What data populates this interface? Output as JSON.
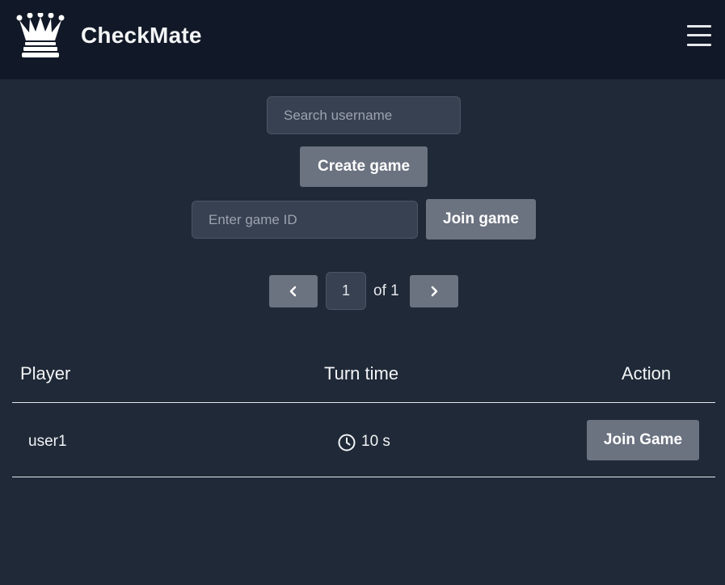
{
  "navbar": {
    "app_title": "CheckMate",
    "logo_icon": "chess-queen-icon",
    "menu_icon": "hamburger-menu-icon"
  },
  "controls": {
    "search_placeholder": "Search username",
    "search_value": "",
    "create_game_label": "Create game",
    "game_id_placeholder": "Enter game ID",
    "game_id_value": "",
    "join_game_label": "Join game"
  },
  "pagination": {
    "prev_icon": "chevron-left-icon",
    "next_icon": "chevron-right-icon",
    "current_page": "1",
    "of_text": "of 1"
  },
  "table": {
    "headers": {
      "player": "Player",
      "turn_time": "Turn time",
      "action": "Action"
    },
    "rows": [
      {
        "player": "user1",
        "turn_time": "10 s",
        "turn_time_icon": "clock-icon",
        "action_label": "Join Game"
      }
    ]
  },
  "colors": {
    "navbar_bg": "#111827",
    "page_bg": "#1f2937",
    "button_bg": "#6b7280",
    "input_bg": "#374151"
  }
}
